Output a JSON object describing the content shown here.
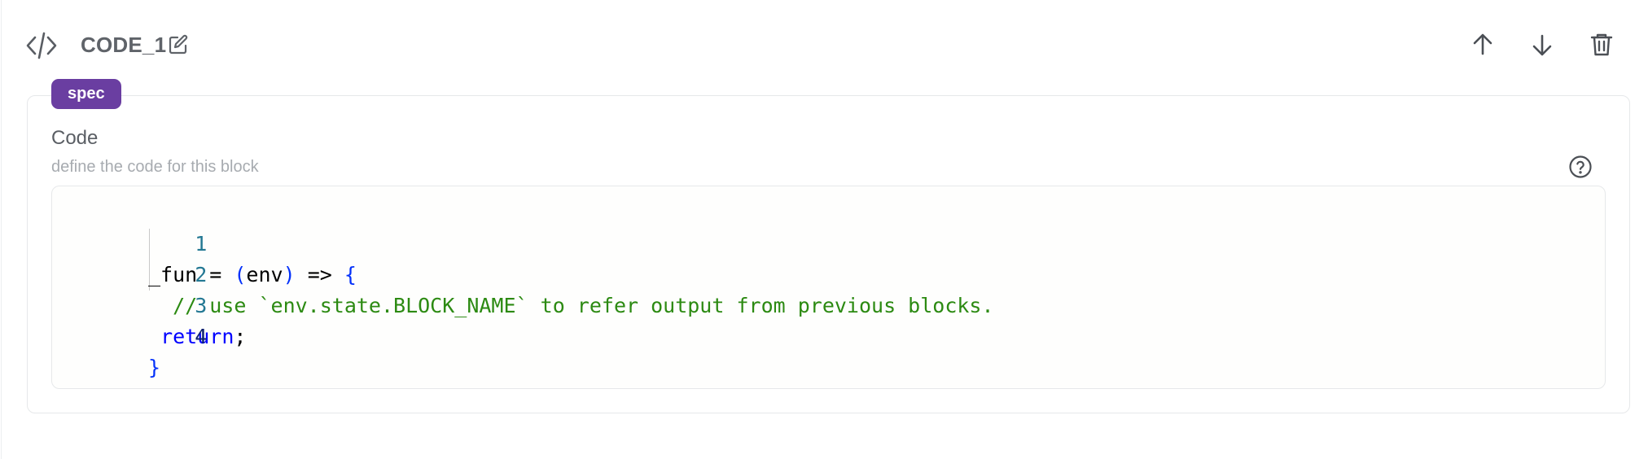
{
  "block": {
    "title": "CODE_1",
    "icon": "code-icon",
    "actions": [
      {
        "name": "move-up",
        "icon": "arrow-up-icon"
      },
      {
        "name": "move-down",
        "icon": "arrow-down-icon"
      },
      {
        "name": "delete",
        "icon": "trash-icon"
      }
    ]
  },
  "spec": {
    "badge": "spec",
    "badge_color": "#6a3ea1"
  },
  "field": {
    "label": "Code",
    "description": "define the code for this block",
    "help_icon": "question-circle-icon"
  },
  "editor": {
    "lines": [
      {
        "number": "1",
        "tokens": [
          {
            "text": "_fun = ",
            "type": "default"
          },
          {
            "text": "(",
            "type": "paren"
          },
          {
            "text": "env",
            "type": "default"
          },
          {
            "text": ")",
            "type": "paren"
          },
          {
            "text": " => ",
            "type": "default"
          },
          {
            "text": "{",
            "type": "paren"
          }
        ]
      },
      {
        "number": "2",
        "tokens": [
          {
            "text": "  // use `env.state.BLOCK_NAME` to refer output from previous blocks.",
            "type": "comment"
          }
        ]
      },
      {
        "number": "3",
        "tokens": [
          {
            "text": " ",
            "type": "default"
          },
          {
            "text": "return",
            "type": "keyword"
          },
          {
            "text": ";",
            "type": "default"
          }
        ]
      },
      {
        "number": "4",
        "tokens": [
          {
            "text": "}",
            "type": "paren"
          }
        ]
      }
    ]
  }
}
